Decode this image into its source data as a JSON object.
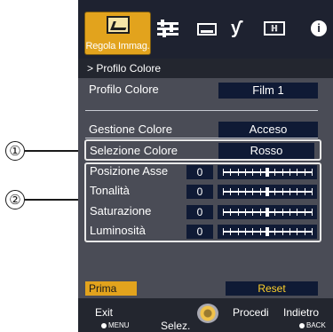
{
  "tabs": {
    "active_label": "Regola Immag.",
    "icons": [
      "picture-adjust-icon",
      "sliders-icon",
      "screen-icon",
      "wrench-icon",
      "hdmi-icon",
      "info-icon"
    ],
    "hdmi_glyph": "ℍ"
  },
  "breadcrumb": "> Profilo Colore",
  "rows": {
    "profile": {
      "label": "Profilo Colore",
      "value": "Film 1"
    },
    "management": {
      "label": "Gestione Colore",
      "value": "Acceso"
    },
    "selection": {
      "label": "Selezione Colore",
      "value": "Rosso"
    }
  },
  "sliders": [
    {
      "label": "Posizione Asse",
      "value": "0"
    },
    {
      "label": "Tonalità",
      "value": "0"
    },
    {
      "label": "Saturazione",
      "value": "0"
    },
    {
      "label": "Luminosità",
      "value": "0"
    }
  ],
  "buttons": {
    "prima": "Prima",
    "reset": "Reset"
  },
  "footer": {
    "exit": "Exit",
    "menu": "MENU",
    "selez": "Selez.",
    "procedi": "Procedi",
    "indietro": "Indietro",
    "back": "BACK"
  },
  "callouts": [
    "①",
    "②"
  ],
  "colors": {
    "accent": "#e2a31d",
    "panel": "#4a4c56",
    "value_bg": "#0f1a35",
    "reset_text": "#ffd12a"
  }
}
